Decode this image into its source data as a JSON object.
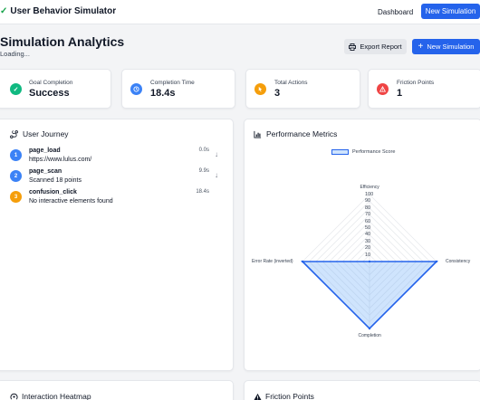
{
  "app": {
    "title": "User Behavior Simulator",
    "nav_dashboard": "Dashboard",
    "nav_new": "New Simulation"
  },
  "header": {
    "title": "Simulation Analytics",
    "status": "Loading...",
    "export_label": "Export Report",
    "new_label": "New Simulation"
  },
  "stats": [
    {
      "label": "Goal Completion",
      "value": "Success",
      "icon": "check-icon",
      "color": "#10b981"
    },
    {
      "label": "Completion Time",
      "value": "18.4s",
      "icon": "clock-icon",
      "color": "#3b82f6"
    },
    {
      "label": "Total Actions",
      "value": "3",
      "icon": "pointer-icon",
      "color": "#f59e0b"
    },
    {
      "label": "Friction Points",
      "value": "1",
      "icon": "warning-icon",
      "color": "#ef4444"
    }
  ],
  "journey": {
    "title": "User Journey",
    "steps": [
      {
        "num": "1",
        "name": "page_load",
        "detail": "https://www.lulus.com/",
        "time": "0.0s",
        "color": "#3b82f6"
      },
      {
        "num": "2",
        "name": "page_scan",
        "detail": "Scanned 18 points",
        "time": "9.9s",
        "color": "#3b82f6"
      },
      {
        "num": "3",
        "name": "confusion_click",
        "detail": "No interactive elements found",
        "time": "18.4s",
        "color": "#f59e0b"
      }
    ]
  },
  "performance": {
    "title": "Performance Metrics"
  },
  "chart_data": {
    "type": "radar",
    "series": [
      {
        "name": "Performance Score",
        "values": [
          0,
          100,
          100,
          100
        ]
      }
    ],
    "axes": [
      "Efficiency",
      "Consistency",
      "Completion",
      "Error Rate (inverted)"
    ],
    "ticks": [
      "10",
      "20",
      "30",
      "40",
      "50",
      "60",
      "70",
      "80",
      "90",
      "100"
    ],
    "range": [
      0,
      100
    ],
    "legend": "top",
    "color": "#2563eb"
  },
  "bottom": {
    "heatmap_title": "Interaction Heatmap",
    "friction_title": "Friction Points"
  },
  "colors": {
    "accent": "#2563eb"
  }
}
